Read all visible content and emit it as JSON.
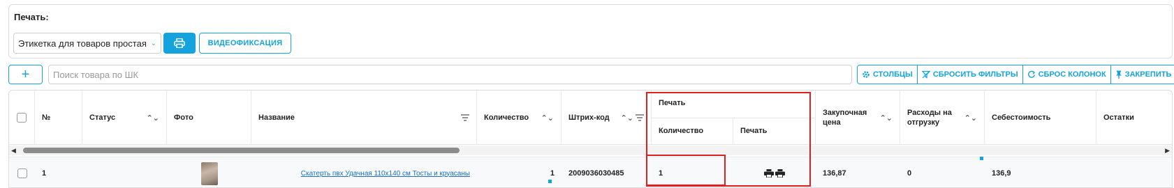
{
  "print_panel": {
    "title": "Печать:",
    "template_select": {
      "value": "Этикетка для товаров простая"
    },
    "print_button_icon": "printer-icon",
    "video_button_label": "ВИДЕОФИКСАЦИЯ"
  },
  "search": {
    "add_icon": "plus-icon",
    "placeholder": "Поиск товара по ШК"
  },
  "toolbar": {
    "columns_label": "СТОЛБЦЫ",
    "reset_filters_label": "СБРОСИТЬ ФИЛЬТРЫ",
    "reset_columns_label": "СБРОС КОЛОНОК",
    "pin_label": "ЗАКРЕПИТЬ"
  },
  "table": {
    "headers": {
      "number": "№",
      "status": "Статус",
      "photo": "Фото",
      "name": "Название",
      "quantity": "Количество",
      "barcode": "Штрих-код",
      "print_group": "Печать",
      "print_quantity": "Количество",
      "print_action": "Печать",
      "purchase_price": "Закупочная цена",
      "shipping_costs": "Расходы на отгрузку",
      "cost_price": "Себестоимость",
      "stock": "Остатки"
    },
    "rows": [
      {
        "number": "1",
        "status": "",
        "name": "Скатерть пвх Удачная 110х140 см Тосты и круасаны",
        "quantity": "1",
        "barcode": "2009036030485",
        "print_quantity": "1",
        "purchase_price": "136,87",
        "shipping_costs": "0",
        "cost_price": "136,9",
        "stock": ""
      }
    ]
  },
  "colors": {
    "accent": "#14a3dd",
    "highlight": "#e02020",
    "link": "#1a6fc2"
  }
}
